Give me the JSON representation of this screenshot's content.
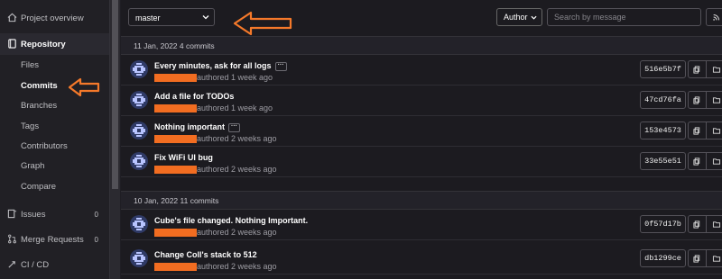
{
  "sidebar": {
    "project_overview": "Project overview",
    "repository": "Repository",
    "sub_items": [
      "Files",
      "Commits",
      "Branches",
      "Tags",
      "Contributors",
      "Graph",
      "Compare"
    ],
    "active_sub": "Commits",
    "issues": {
      "label": "Issues",
      "count": "0"
    },
    "merge_requests": {
      "label": "Merge Requests",
      "count": "0"
    },
    "cicd": "CI / CD"
  },
  "toolbar": {
    "branch": "master",
    "author_label": "Author",
    "search_placeholder": "Search by message"
  },
  "commit_days": [
    {
      "header": "11 Jan, 2022 4 commits",
      "commits": [
        {
          "title": "Every minutes, ask for all logs",
          "has_more": true,
          "authored": "authored 1 week ago",
          "sha": "516e5b7f"
        },
        {
          "title": "Add a file for TODOs",
          "has_more": false,
          "authored": "authored 1 week ago",
          "sha": "47cd76fa"
        },
        {
          "title": "Nothing important",
          "has_more": true,
          "authored": "authored 2 weeks ago",
          "sha": "153e4573"
        },
        {
          "title": "Fix WiFi UI bug",
          "has_more": false,
          "authored": "authored 2 weeks ago",
          "sha": "33e55e51"
        }
      ]
    },
    {
      "header": "10 Jan, 2022 11 commits",
      "commits": [
        {
          "title": "Cube's file changed. Nothing Important.",
          "has_more": false,
          "authored": "authored 2 weeks ago",
          "sha": "0f57d17b"
        },
        {
          "title": "Change Coll's stack to 512",
          "has_more": false,
          "authored": "authored 2 weeks ago",
          "sha": "db1299ce"
        }
      ]
    }
  ],
  "colors": {
    "annotation_arrow": "#f5792a",
    "redaction": "#f26d21",
    "avatar": "#2f3a66"
  },
  "more_glyph": "···"
}
